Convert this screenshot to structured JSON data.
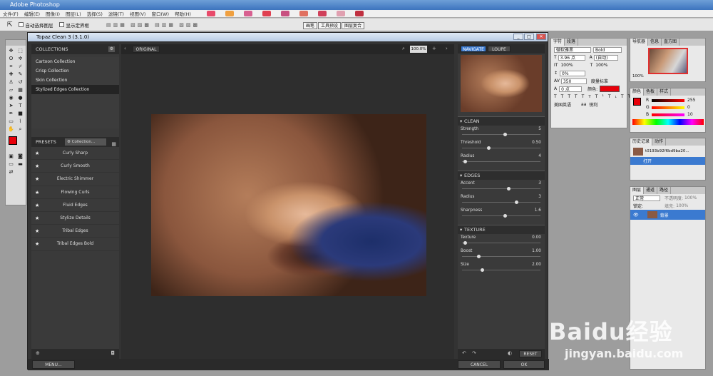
{
  "ps": {
    "title": "Adobe Photoshop",
    "menu": [
      "文件(F)",
      "编辑(E)",
      "图像(I)",
      "图层(L)",
      "选择(S)",
      "滤镜(T)",
      "视图(V)",
      "窗口(W)",
      "帮助(H)"
    ],
    "options": {
      "auto_select": "自动选择图层",
      "show_bounds": "显示定界框"
    },
    "workspace_tabs": [
      "画笔",
      "工具预设",
      "图层复合"
    ]
  },
  "topaz": {
    "title": "Topaz Clean 3 (3.1.0)",
    "collections_head": "COLLECTIONS",
    "collections": [
      "Cartoon Collection",
      "Crisp Collection",
      "Skin Collection",
      "Stylized Edges Collection"
    ],
    "presets_head": "PRESETS",
    "presets_filter": "Collection...",
    "presets": [
      "Curly Sharp",
      "Curly Smooth",
      "Electric Shimmer",
      "Flowing Curls",
      "Fluid Edges",
      "Stylize Details",
      "Tribal Edges",
      "Tribal Edges Bold"
    ],
    "view_label": "ORIGINAL",
    "zoom": "100.0%",
    "nav_tabs": [
      "NAVIGATE",
      "LOUPE"
    ],
    "sections": [
      {
        "title": "CLEAN",
        "controls": [
          {
            "label": "Strength",
            "value": "5",
            "pos": 0.55
          },
          {
            "label": "Threshold",
            "value": "0.50",
            "pos": 0.33
          },
          {
            "label": "Radius",
            "value": "4",
            "pos": 0.02
          }
        ]
      },
      {
        "title": "EDGES",
        "controls": [
          {
            "label": "Accent",
            "value": "3",
            "pos": 0.6
          },
          {
            "label": "Radius",
            "value": "3",
            "pos": 0.7
          },
          {
            "label": "Sharpness",
            "value": "1.6",
            "pos": 0.55
          }
        ]
      },
      {
        "title": "TEXTURE",
        "controls": [
          {
            "label": "Texture",
            "value": "0.00",
            "pos": 0.02
          },
          {
            "label": "Boost",
            "value": "1.00",
            "pos": 0.2
          },
          {
            "label": "Size",
            "value": "2.00",
            "pos": 0.25
          }
        ]
      }
    ],
    "reset_label": "RESET",
    "menu_label": "MENU...",
    "cancel_label": "CANCEL",
    "ok_label": "OK"
  },
  "char_panel": {
    "tabs": [
      "字符",
      "段落"
    ],
    "font": "微软雅黑",
    "style": "Bold",
    "size": "3.96 点",
    "leading": "(自动)",
    "scale_v": "100%",
    "scale_h": "100%",
    "baseline": "0%",
    "tracking": "350",
    "kerning": "度量标准",
    "shift": "0 点",
    "color_label": "颜色:",
    "lang": "美国英语",
    "aa": "锐利"
  },
  "nav_panel": {
    "tabs": [
      "导航器",
      "信息",
      "直方图"
    ],
    "zoom": "100%"
  },
  "color_panel": {
    "tabs": [
      "颜色",
      "色板",
      "样式"
    ],
    "r": "255",
    "g": "0",
    "b": "10"
  },
  "history_panel": {
    "tabs": [
      "历史记录",
      "动作"
    ],
    "doc": "t0193b92f6bd9ba20...",
    "open": "打开"
  },
  "layers_panel": {
    "tabs": [
      "图层",
      "通道",
      "路径"
    ],
    "mode": "正常",
    "opacity_label": "不透明度:",
    "opacity": "100%",
    "lock_label": "锁定:",
    "fill_label": "填充:",
    "fill": "100%",
    "layer_name": "背景"
  },
  "watermark": {
    "brand": "Baidu经验",
    "url": "jingyan.baidu.com"
  },
  "colors": {
    "fg": "#e8000a",
    "accent": "#3b7ad0"
  }
}
